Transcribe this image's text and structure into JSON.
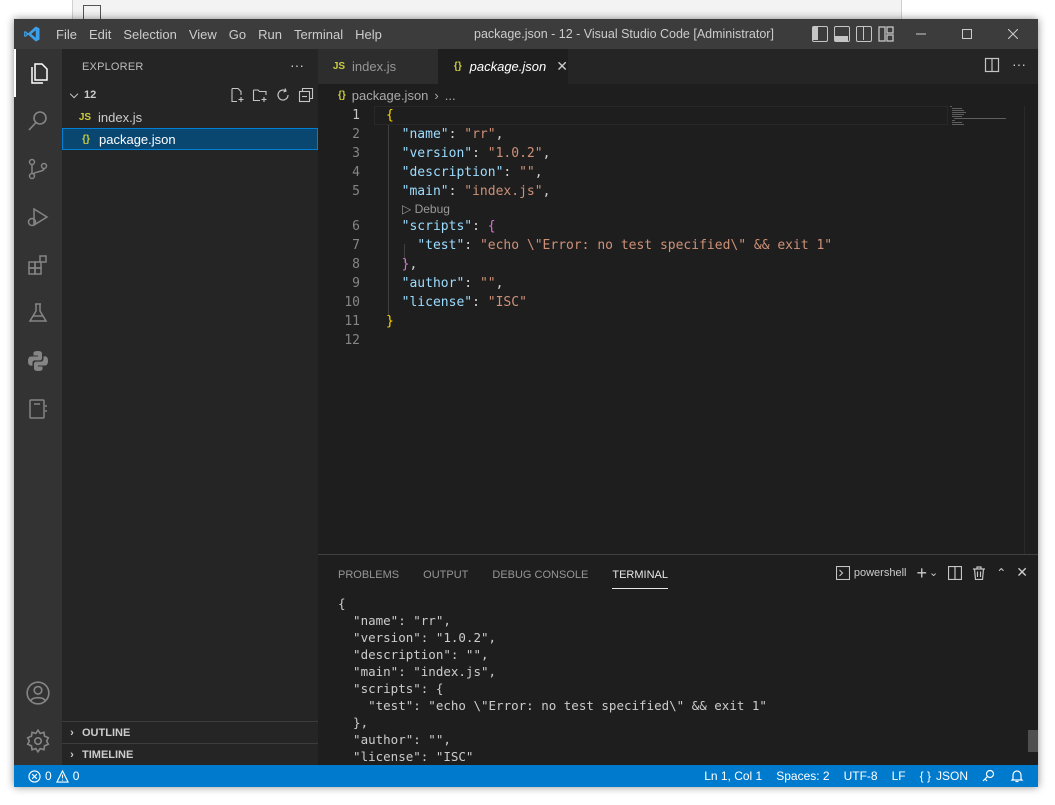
{
  "window": {
    "title": "package.json - 12 - Visual Studio Code [Administrator]"
  },
  "menu": [
    "File",
    "Edit",
    "Selection",
    "View",
    "Go",
    "Run",
    "Terminal",
    "Help"
  ],
  "sidebar": {
    "title": "EXPLORER",
    "more": "···",
    "folder": "12",
    "files": [
      {
        "icon": "JS",
        "name": "index.js"
      },
      {
        "icon": "{}",
        "name": "package.json"
      }
    ],
    "sections": [
      "OUTLINE",
      "TIMELINE"
    ]
  },
  "tabs": [
    {
      "icon": "JS",
      "label": "index.js"
    },
    {
      "icon": "{}",
      "label": "package.json"
    }
  ],
  "breadcrumb": {
    "icon": "{}",
    "file": "package.json",
    "sep": "›",
    "more": "..."
  },
  "editor": {
    "line_numbers": [
      "1",
      "2",
      "3",
      "4",
      "5",
      "6",
      "7",
      "8",
      "9",
      "10",
      "11",
      "12"
    ],
    "codelens": "Debug",
    "lines": {
      "l1": "{",
      "l2k": "\"name\"",
      "l2v": "\"rr\"",
      "l3k": "\"version\"",
      "l3v": "\"1.0.2\"",
      "l4k": "\"description\"",
      "l4v": "\"\"",
      "l5k": "\"main\"",
      "l5v": "\"index.js\"",
      "l6k": "\"scripts\"",
      "l6b": "{",
      "l7k": "\"test\"",
      "l7v": "\"echo \\\"Error: no test specified\\\" && exit 1\"",
      "l8b": "}",
      "l9k": "\"author\"",
      "l9v": "\"\"",
      "l10k": "\"license\"",
      "l10v": "\"ISC\"",
      "l11": "}"
    }
  },
  "panel": {
    "tabs": [
      "PROBLEMS",
      "OUTPUT",
      "DEBUG CONSOLE",
      "TERMINAL"
    ],
    "shell": "powershell",
    "terminal_lines": [
      "{",
      "  \"name\": \"rr\",",
      "  \"version\": \"1.0.2\",",
      "  \"description\": \"\",",
      "  \"main\": \"index.js\",",
      "  \"scripts\": {",
      "    \"test\": \"echo \\\"Error: no test specified\\\" && exit 1\"",
      "  },",
      "  \"author\": \"\",",
      "  \"license\": \"ISC\""
    ]
  },
  "status": {
    "errors": "0",
    "warnings": "0",
    "position": "Ln 1, Col 1",
    "spaces": "Spaces: 2",
    "encoding": "UTF-8",
    "eol": "LF",
    "language": "JSON"
  },
  "colors": {
    "accent": "#007acc",
    "selection": "#094771",
    "titlebar": "#3c3c3c"
  }
}
